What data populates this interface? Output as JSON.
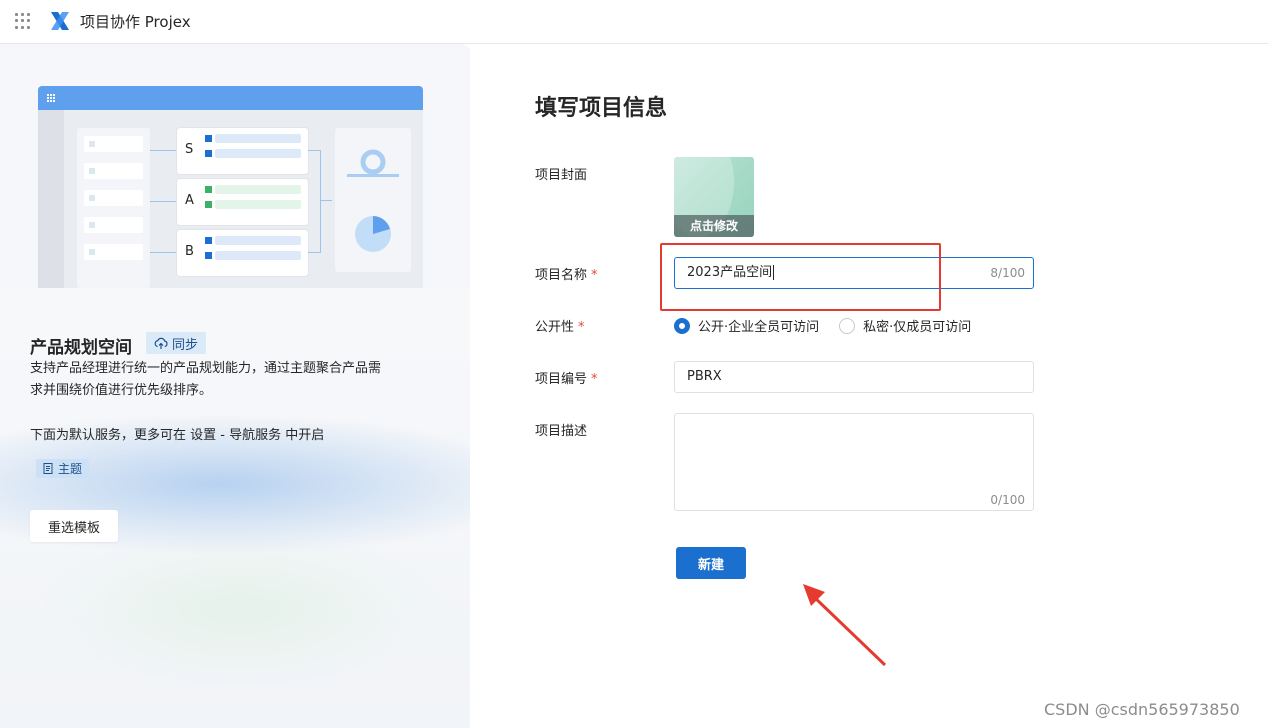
{
  "header": {
    "app_title": "项目协作 Projex",
    "apps_icon": "grid-apps-icon",
    "logo_icon": "projex-logo-icon"
  },
  "template": {
    "title": "产品规划空间",
    "sync_badge": "同步",
    "description": "支持产品经理进行统一的产品规划能力，通过主题聚合产品需求并围绕价值进行优先级排序。",
    "note": "下面为默认服务，更多可在 设置 - 导航服务 中开启",
    "service_tag": "主题",
    "reselect_button": "重选模板",
    "preview": {
      "cards": [
        "S",
        "A",
        "B"
      ]
    }
  },
  "form": {
    "title": "填写项目信息",
    "cover": {
      "label": "项目封面",
      "edit_label": "点击修改"
    },
    "name": {
      "label": "项目名称",
      "required_mark": "*",
      "value": "2023产品空间",
      "counter": "8/100"
    },
    "visibility": {
      "label": "公开性",
      "required_mark": "*",
      "options": [
        "公开·企业全员可访问",
        "私密·仅成员可访问"
      ],
      "selected": "公开·企业全员可访问"
    },
    "code": {
      "label": "项目编号",
      "required_mark": "*",
      "value": "PBRX"
    },
    "description": {
      "label": "项目描述",
      "value": "",
      "counter": "0/100"
    },
    "submit_button": "新建"
  },
  "annotations": {
    "highlight_color": "#e53a2f",
    "arrow_color": "#e53a2f"
  },
  "watermark": "CSDN @csdn565973850",
  "colors": {
    "primary": "#1b6fcf",
    "required": "#e8483a"
  }
}
